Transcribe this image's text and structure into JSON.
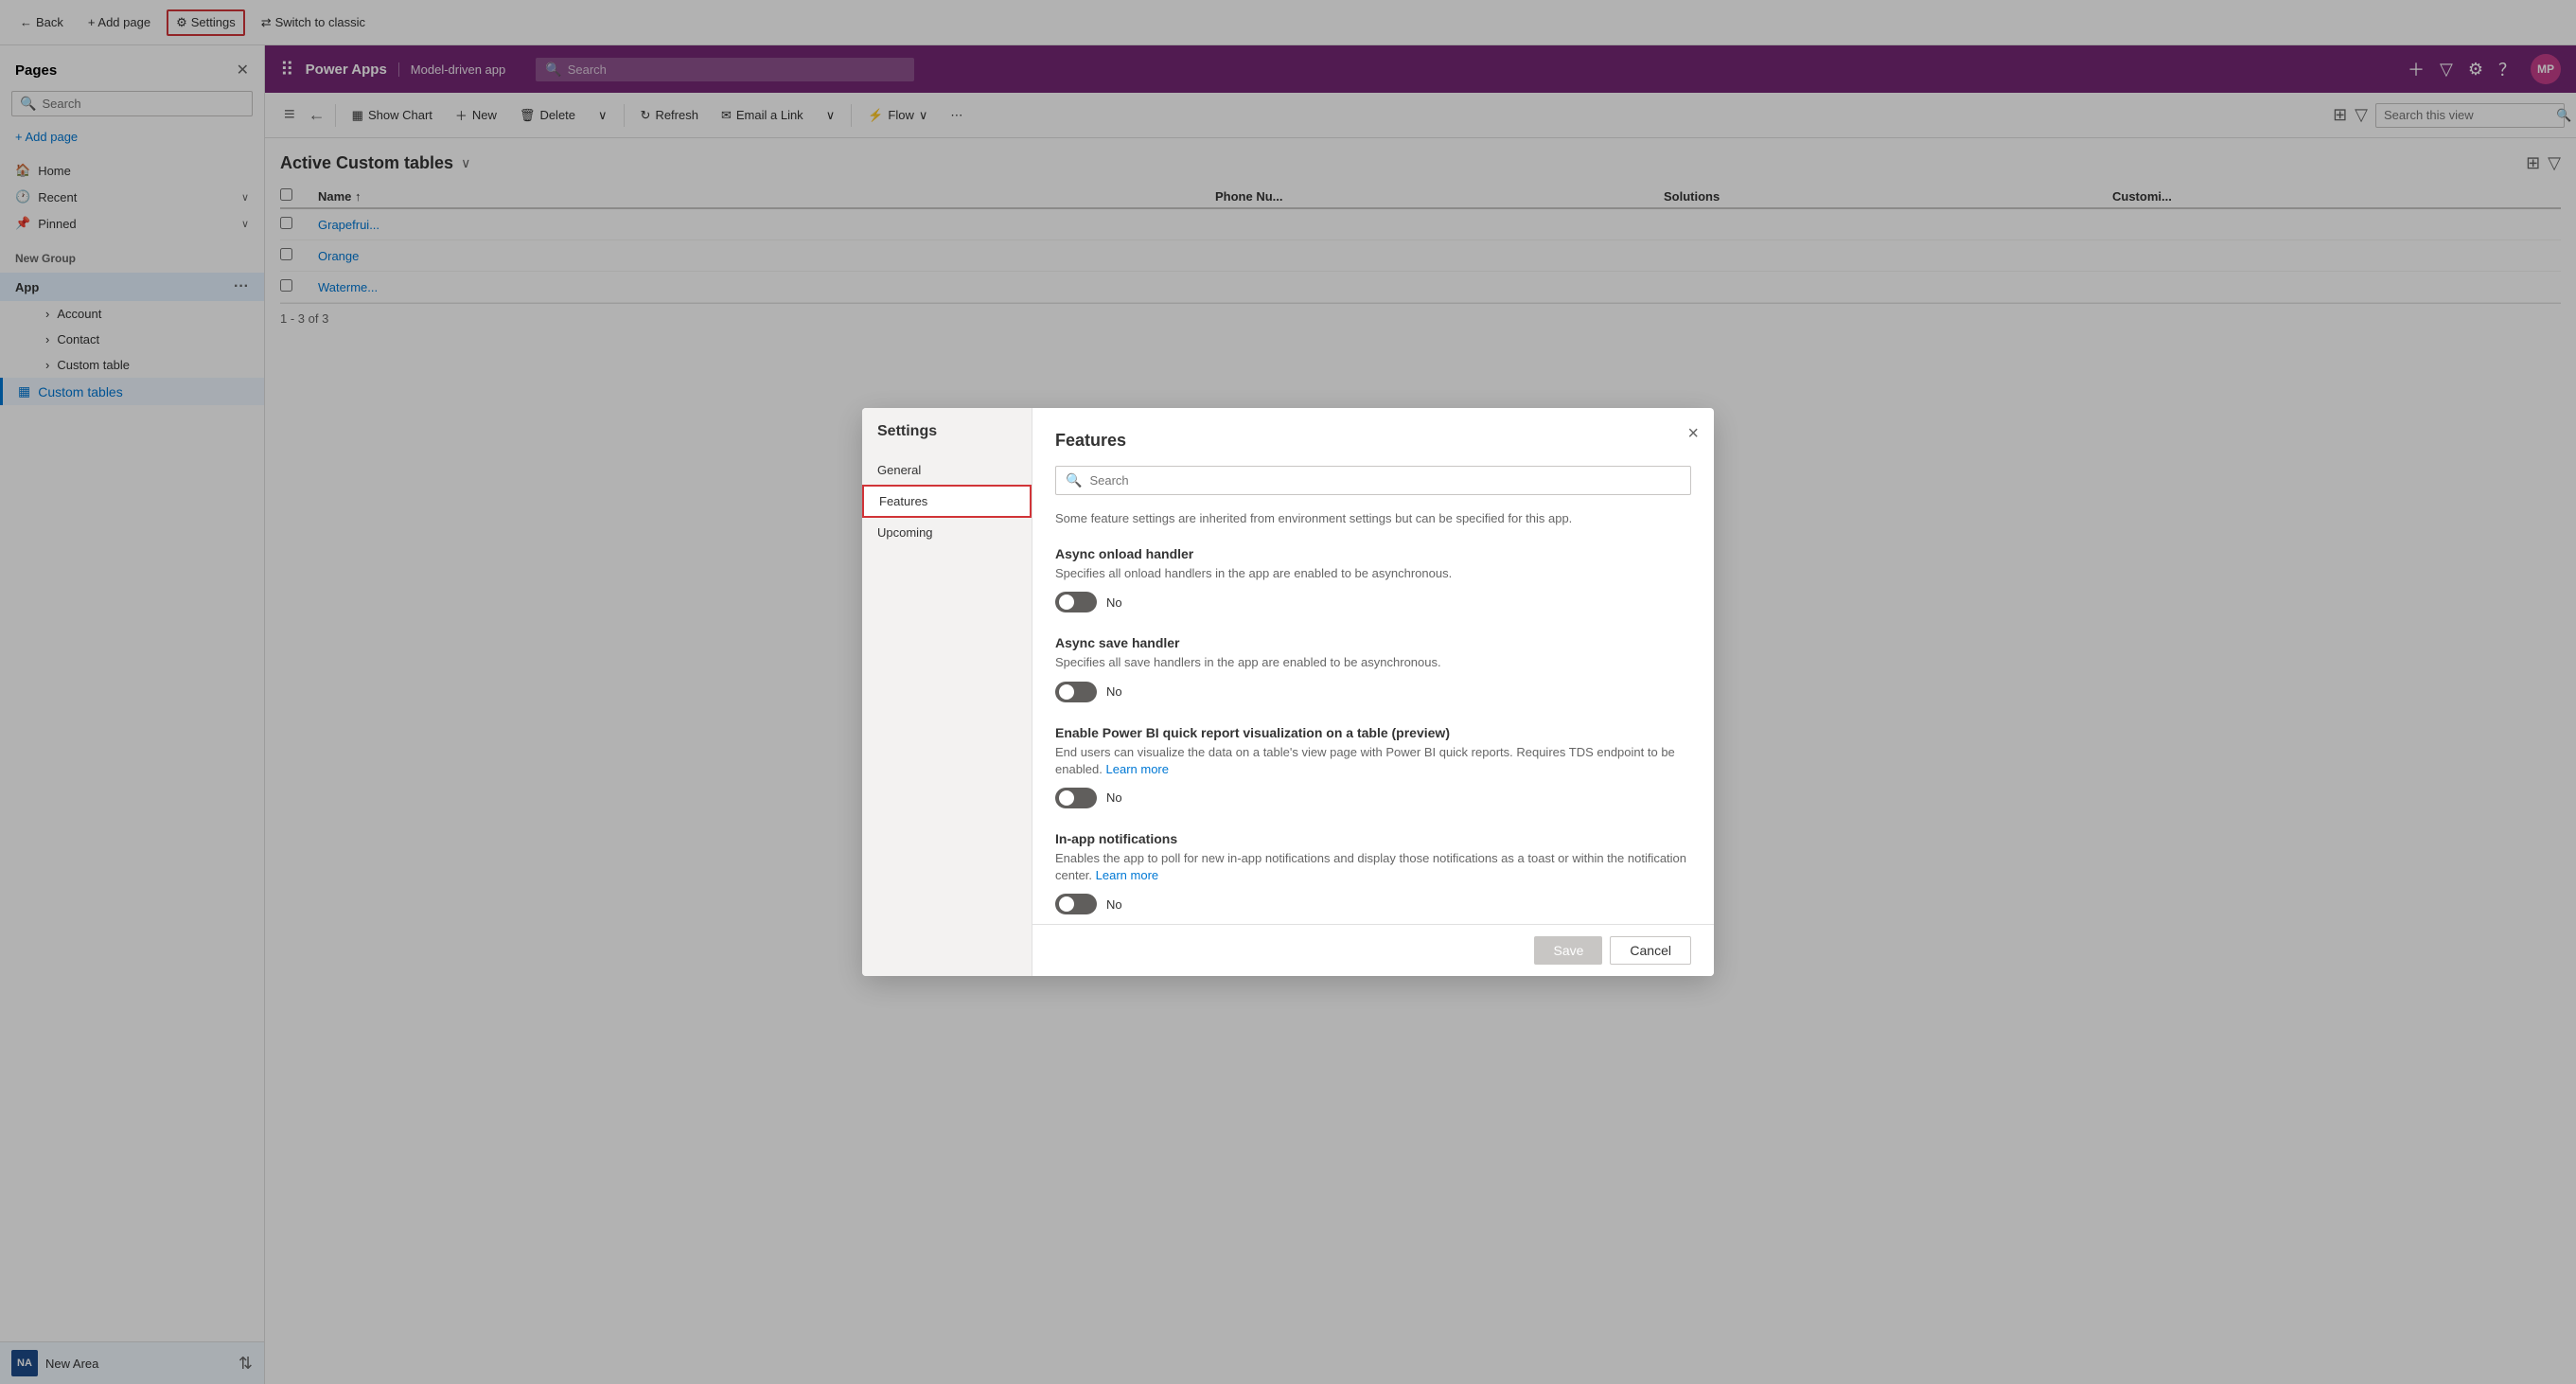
{
  "topBar": {
    "backLabel": "Back",
    "addPageLabel": "+ Add page",
    "settingsLabel": "Settings",
    "switchToClassicLabel": "Switch to classic"
  },
  "pagesPanel": {
    "title": "Pages",
    "searchPlaceholder": "Search",
    "addPageLabel": "+ Add page",
    "navItems": [
      {
        "id": "home",
        "label": "Home",
        "icon": "🏠"
      },
      {
        "id": "recent",
        "label": "Recent",
        "icon": "🕐",
        "hasChevron": true
      },
      {
        "id": "pinned",
        "label": "Pinned",
        "icon": "📌",
        "hasChevron": true
      }
    ],
    "newGroupLabel": "New Group",
    "appLabel": "App",
    "subItems": [
      {
        "id": "account",
        "label": "Account"
      },
      {
        "id": "contact",
        "label": "Contact"
      },
      {
        "id": "customTable",
        "label": "Custom table"
      }
    ],
    "customTablesLabel": "Custom tables",
    "bottomBar": {
      "badge": "NA",
      "label": "New Area",
      "pagination": "1 - 3 of 3"
    }
  },
  "paHeader": {
    "gridIcon": "⋮⋮⋮",
    "title": "Power Apps",
    "appName": "Model-driven app",
    "searchPlaceholder": "Search",
    "avatarText": "MP"
  },
  "toolbar": {
    "showChartLabel": "Show Chart",
    "newLabel": "New",
    "deleteLabel": "Delete",
    "refreshLabel": "Refresh",
    "emailLinkLabel": "Email a Link",
    "flowLabel": "Flow",
    "moreOptions": "⋯",
    "searchThisViewPlaceholder": "Search this view"
  },
  "tableArea": {
    "title": "Active Custom tables",
    "rows": [
      {
        "name": "Grapefrui..."
      },
      {
        "name": "Orange"
      },
      {
        "name": "Waterme..."
      }
    ]
  },
  "settingsDialog": {
    "title": "Settings",
    "closeLabel": "×",
    "navItems": [
      {
        "id": "general",
        "label": "General"
      },
      {
        "id": "features",
        "label": "Features",
        "selected": true
      },
      {
        "id": "upcoming",
        "label": "Upcoming"
      }
    ],
    "contentTitle": "Features",
    "searchPlaceholder": "Search",
    "subtitle": "Some feature settings are inherited from environment settings but can be specified for this app.",
    "features": [
      {
        "id": "async-onload",
        "title": "Async onload handler",
        "desc": "Specifies all onload handlers in the app are enabled to be asynchronous.",
        "toggleState": "off",
        "toggleLabel": "No",
        "hasLink": false
      },
      {
        "id": "async-save",
        "title": "Async save handler",
        "desc": "Specifies all save handlers in the app are enabled to be asynchronous.",
        "toggleState": "off",
        "toggleLabel": "No",
        "hasLink": false
      },
      {
        "id": "power-bi",
        "title": "Enable Power BI quick report visualization on a table (preview)",
        "descPre": "End users can visualize the data on a table's view page with Power BI quick reports. Requires TDS endpoint to be enabled.",
        "linkText": "Learn more",
        "toggleState": "off",
        "toggleLabel": "No",
        "hasLink": true
      },
      {
        "id": "in-app-notifications",
        "title": "In-app notifications",
        "descPre": "Enables the app to poll for new in-app notifications and display those notifications as a toast or within the notification center.",
        "linkText": "Learn more",
        "toggleState": "off",
        "toggleLabel": "No",
        "hasLink": true
      }
    ],
    "footer": {
      "saveLabel": "Save",
      "cancelLabel": "Cancel"
    }
  },
  "colors": {
    "accent": "#742774",
    "blue": "#0078d4",
    "danger": "#d13438"
  }
}
